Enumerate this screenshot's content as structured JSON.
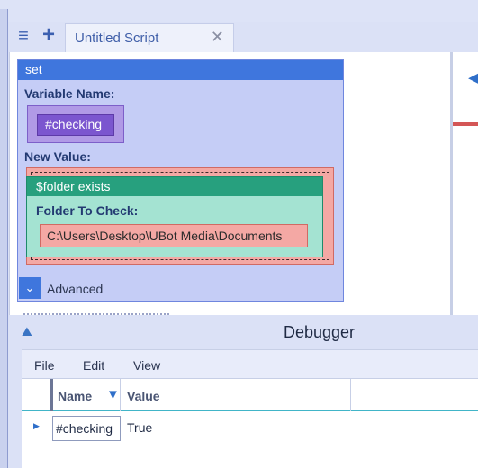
{
  "tabbar": {
    "menu_icon": "hamburger-menu-icon",
    "add_icon": "plus-icon",
    "tab_title": "Untitled Script",
    "tab_close_icon": "close-icon"
  },
  "set_command": {
    "header": "set",
    "variable_name_label": "Variable Name:",
    "variable_value": "#checking",
    "new_value_label": "New Value:",
    "folder_exists": {
      "header": "$folder exists",
      "folder_label": "Folder To Check:",
      "path": "C:\\Users\\Desktop\\UBot Media\\Documents"
    },
    "advanced_label": "Advanced",
    "advanced_icon": "chevron-down-icon"
  },
  "debugger": {
    "title": "Debugger",
    "pin_icon": "pin-icon",
    "menu": [
      "File",
      "Edit",
      "View"
    ],
    "columns": {
      "name": "Name",
      "value": "Value",
      "filter_icon": "filter-icon"
    },
    "rows": [
      {
        "name": "#checking",
        "value": "True"
      }
    ]
  },
  "colors": {
    "accent_blue": "#3f76dd",
    "variable_purple": "#7b56cf",
    "function_green": "#27a07e",
    "value_red": "#f4a8a4"
  }
}
